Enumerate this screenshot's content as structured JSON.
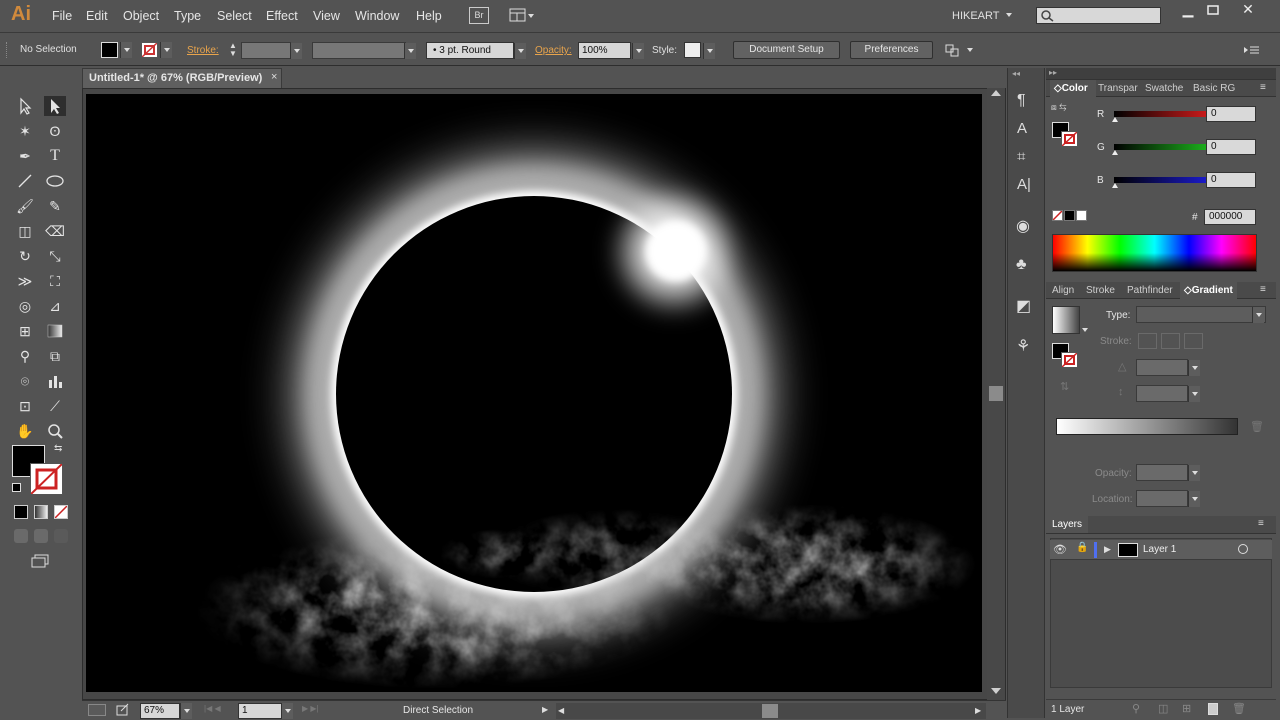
{
  "menubar": {
    "logo": "Ai",
    "items": [
      "File",
      "Edit",
      "Object",
      "Type",
      "Select",
      "Effect",
      "View",
      "Window",
      "Help"
    ],
    "bridge": "Br",
    "workspace": "HIKEART"
  },
  "control": {
    "selection": "No Selection",
    "stroke_label": "Stroke:",
    "brush": "3 pt. Round",
    "opacity_label": "Opacity:",
    "opacity_value": "100%",
    "style_label": "Style:",
    "doc_setup": "Document Setup",
    "preferences": "Preferences"
  },
  "document": {
    "tab_title": "Untitled-1* @ 67% (RGB/Preview)"
  },
  "status": {
    "zoom": "67%",
    "page": "1",
    "tool": "Direct Selection"
  },
  "color_panel": {
    "tabs": [
      "Color",
      "Transpar",
      "Swatche",
      "Basic RG"
    ],
    "channels": [
      {
        "name": "R",
        "value": "0",
        "color": "#e01d1d"
      },
      {
        "name": "G",
        "value": "0",
        "color": "#1fc21f"
      },
      {
        "name": "B",
        "value": "0",
        "color": "#1d1de0"
      }
    ],
    "hex_label": "#",
    "hex_value": "000000"
  },
  "gradient_panel": {
    "tabs": [
      "Align",
      "Stroke",
      "Pathfinder",
      "Gradient"
    ],
    "type_label": "Type:",
    "stroke_label": "Stroke:",
    "opacity_label": "Opacity:",
    "location_label": "Location:"
  },
  "layers_panel": {
    "title": "Layers",
    "layer_name": "Layer 1",
    "count": "1 Layer"
  }
}
